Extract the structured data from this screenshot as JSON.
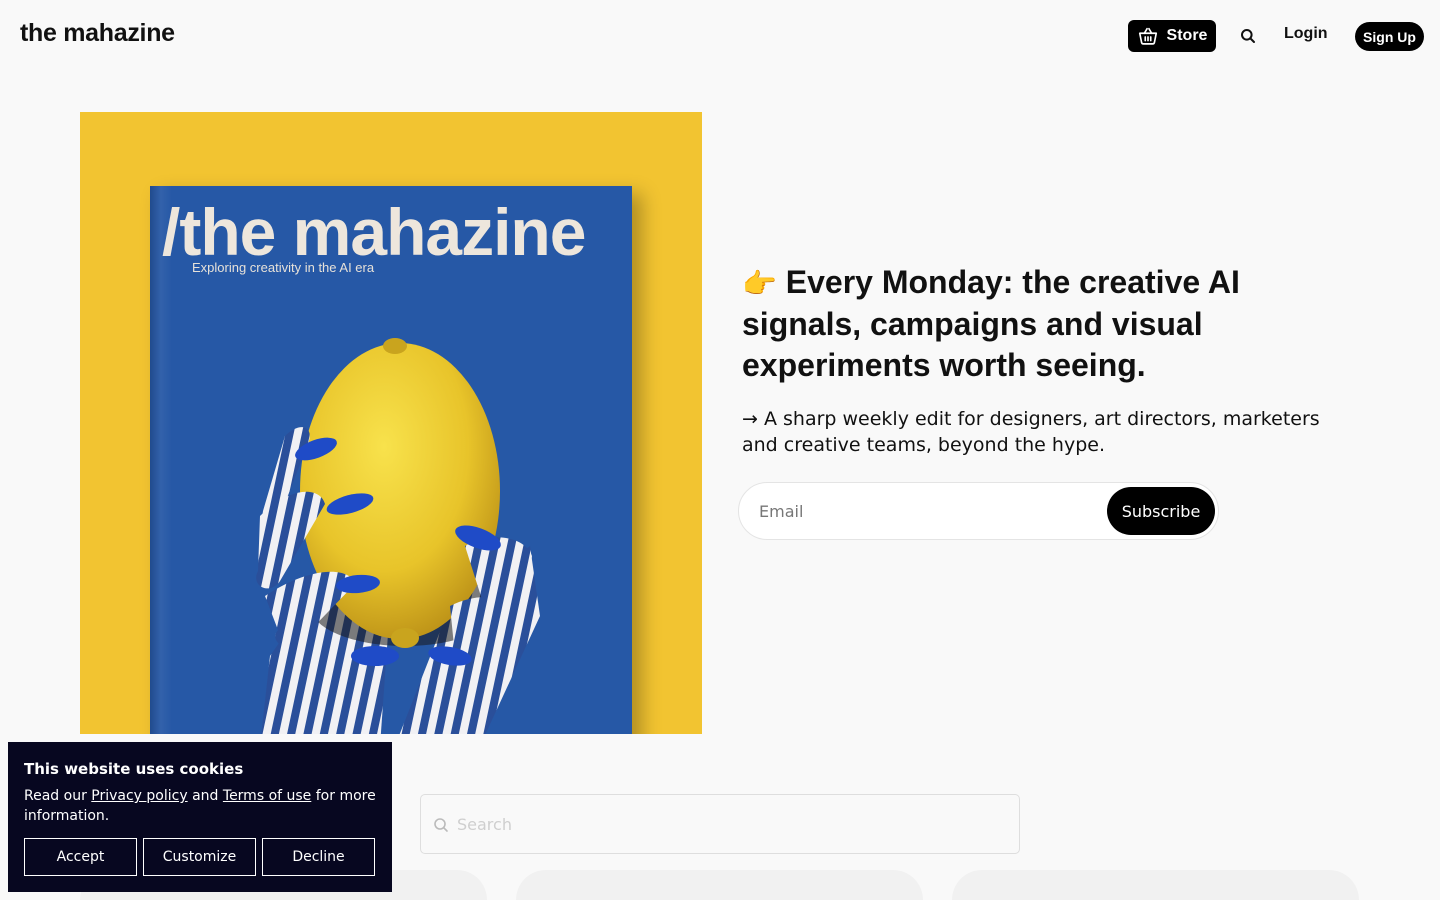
{
  "header": {
    "logo": "the mahazine",
    "store_label": "Store",
    "login_label": "Login",
    "signup_label": "Sign Up"
  },
  "hero": {
    "cover": {
      "title": "/the mahazine",
      "subtitle": "Exploring creativity in the AI era"
    },
    "pointer_emoji": "👉",
    "heading": "Every Monday: the creative AI signals, campaigns and visual experiments worth seeing.",
    "subheading": "→ A sharp weekly edit for designers, art directors, marketers and creative teams, beyond the hype.",
    "email_placeholder": "Email",
    "subscribe_label": "Subscribe"
  },
  "content_search": {
    "placeholder": "Search"
  },
  "cookie_banner": {
    "title": "This website uses cookies",
    "text_before": "Read our ",
    "privacy_link": "Privacy policy",
    "text_middle": " and ",
    "terms_link": "Terms of use",
    "text_after": " for more information.",
    "accept_label": "Accept",
    "customize_label": "Customize",
    "decline_label": "Decline"
  },
  "colors": {
    "cover_background": "#f2c431",
    "magazine_blue": "#2658a6",
    "cookie_background": "#070720",
    "button_black": "#000000"
  },
  "icons": [
    "basket-icon",
    "search-icon",
    "pointing-hand-emoji"
  ]
}
